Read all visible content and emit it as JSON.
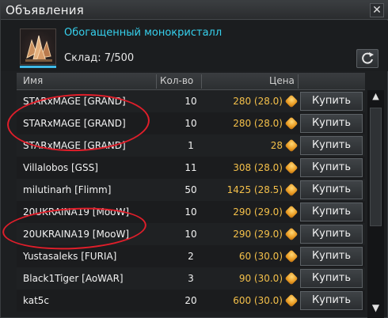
{
  "window": {
    "title": "Объявления",
    "close_symbol": "✕"
  },
  "item": {
    "name": "Обогащенный монокристалл",
    "stock": "Склад: 7/500"
  },
  "table": {
    "headers": {
      "name": "Имя",
      "qty": "Кол-во",
      "price": "Цена"
    },
    "rows": [
      {
        "name": "STARxMAGE [GRAND]",
        "qty": "10",
        "price": "280 (28.0)",
        "buy": "Купить"
      },
      {
        "name": "STARxMAGE [GRAND]",
        "qty": "10",
        "price": "280 (28.0)",
        "buy": "Купить"
      },
      {
        "name": "STARxMAGE [GRAND]",
        "qty": "1",
        "price": "28",
        "buy": "Купить"
      },
      {
        "name": "Villalobos [GSS]",
        "qty": "11",
        "price": "308 (28.0)",
        "buy": "Купить"
      },
      {
        "name": "milutinarh [Flimm]",
        "qty": "50",
        "price": "1425 (28.5)",
        "buy": "Купить"
      },
      {
        "name": "20UKRAINA19 [MooW]",
        "qty": "10",
        "price": "290 (29.0)",
        "buy": "Купить"
      },
      {
        "name": "20UKRAINA19 [MooW]",
        "qty": "10",
        "price": "290 (29.0)",
        "buy": "Купить"
      },
      {
        "name": "Yustasaleks [FURIA]",
        "qty": "2",
        "price": "60 (30.0)",
        "buy": "Купить"
      },
      {
        "name": "Black1Tiger [AoWAR]",
        "qty": "3",
        "price": "90 (30.0)",
        "buy": "Купить"
      },
      {
        "name": "kat5c",
        "qty": "20",
        "price": "600 (30.0)",
        "buy": "Купить"
      }
    ]
  },
  "colors": {
    "accent": "#36d1ee",
    "price": "#f4c04a",
    "annotation": "#e01e2a"
  }
}
